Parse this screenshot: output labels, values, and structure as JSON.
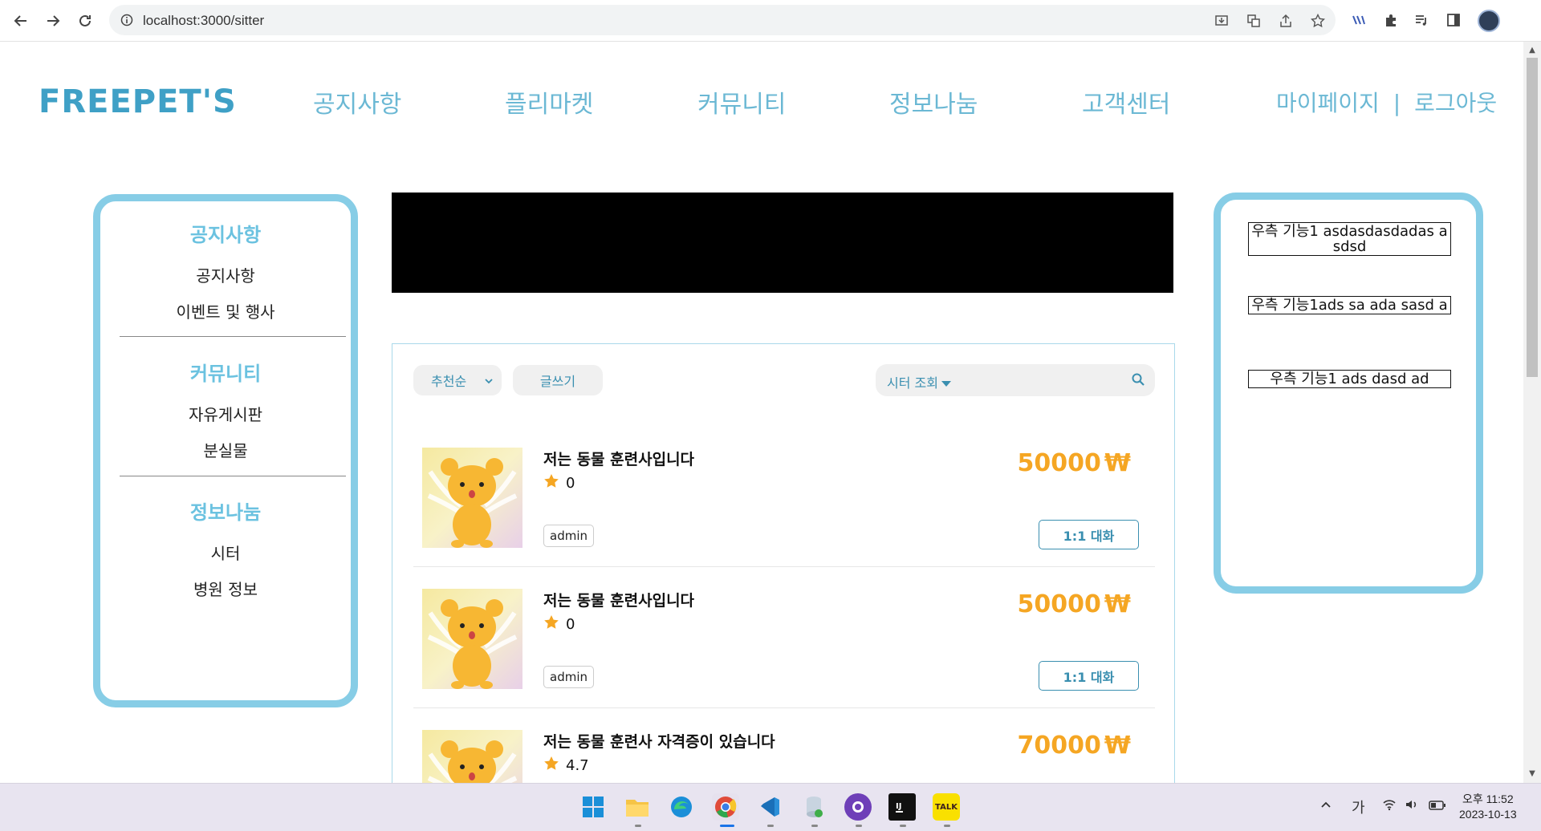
{
  "browser": {
    "url": "localhost:3000/sitter"
  },
  "header": {
    "logo": "FREEPET'S",
    "nav": [
      "공지사항",
      "플리마켓",
      "커뮤니티",
      "정보나눔",
      "고객센터"
    ],
    "mypage": "마이페이지",
    "separator": "|",
    "logout": "로그아웃"
  },
  "sidebar": {
    "sections": [
      {
        "heading": "공지사항",
        "items": [
          "공지사항",
          "이벤트 및 행사"
        ]
      },
      {
        "heading": "커뮤니티",
        "items": [
          "자유게시판",
          "분실물"
        ]
      },
      {
        "heading": "정보나눔",
        "items": [
          "시터",
          "병원 정보"
        ]
      }
    ]
  },
  "toolbar": {
    "sort_label": "추천순",
    "write_label": "글쓰기",
    "search_type": "시터 조회",
    "search_value": ""
  },
  "posts": [
    {
      "title": "저는 동물 훈련사입니다",
      "rating": "0",
      "price": "50000",
      "currency": "₩",
      "author": "admin",
      "chat": "1:1 대화"
    },
    {
      "title": "저는 동물 훈련사입니다",
      "rating": "0",
      "price": "50000",
      "currency": "₩",
      "author": "admin",
      "chat": "1:1 대화"
    },
    {
      "title": "저는 동물 훈련사 자격증이 있습니다",
      "rating": "4.7",
      "price": "70000",
      "currency": "₩",
      "author": "",
      "chat": ""
    }
  ],
  "right_panel": {
    "features": [
      "우측 기능1 asdasdasdadas asdsd",
      "우측 기능1ads sa ada sasd a",
      "우측 기능1 ads dasd ad"
    ]
  },
  "taskbar": {
    "ime": "가",
    "time_period": "오후 11:52",
    "date": "2023-10-13",
    "kakao_label": "TALK"
  },
  "colors": {
    "accent": "#87cde6",
    "nav_text": "#6bb8d4",
    "price": "#f5a623",
    "link_blue": "#3a8fb0"
  }
}
